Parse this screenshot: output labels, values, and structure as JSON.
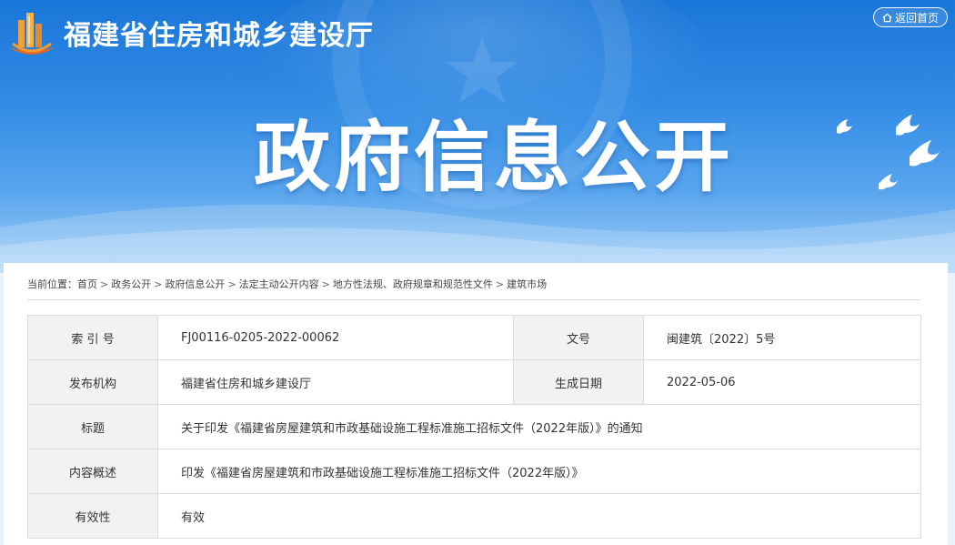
{
  "header": {
    "site_title": "福建省住房和城乡建设厅",
    "home_button": "返回首页",
    "banner_title": "政府信息公开"
  },
  "breadcrumb": {
    "prefix": "当前位置：",
    "items": [
      "首页",
      "政务公开",
      "政府信息公开",
      "法定主动公开内容",
      "地方性法规、政府规章和规范性文件",
      "建筑市场"
    ]
  },
  "info": {
    "index_label": "索 引 号",
    "index_value": "FJ00116-0205-2022-00062",
    "doc_no_label": "文号",
    "doc_no_value": "闽建筑〔2022〕5号",
    "publisher_label": "发布机构",
    "publisher_value": "福建省住房和城乡建设厅",
    "date_label": "生成日期",
    "date_value": "2022-05-06",
    "title_label": "标题",
    "title_value": "关于印发《福建省房屋建筑和市政基础设施工程标准施工招标文件（2022年版）》的通知",
    "summary_label": "内容概述",
    "summary_value": "印发《福建省房屋建筑和市政基础设施工程标准施工招标文件（2022年版）》",
    "validity_label": "有效性",
    "validity_value": "有效"
  },
  "icons": {
    "logo": "building-logo-icon",
    "home": "home-icon",
    "birds": "dove-icon"
  },
  "colors": {
    "banner_top": "#1a76d8",
    "banner_bottom": "#9fcdf6",
    "label_bg": "#f2f2f2",
    "border": "#dcdcdc"
  }
}
